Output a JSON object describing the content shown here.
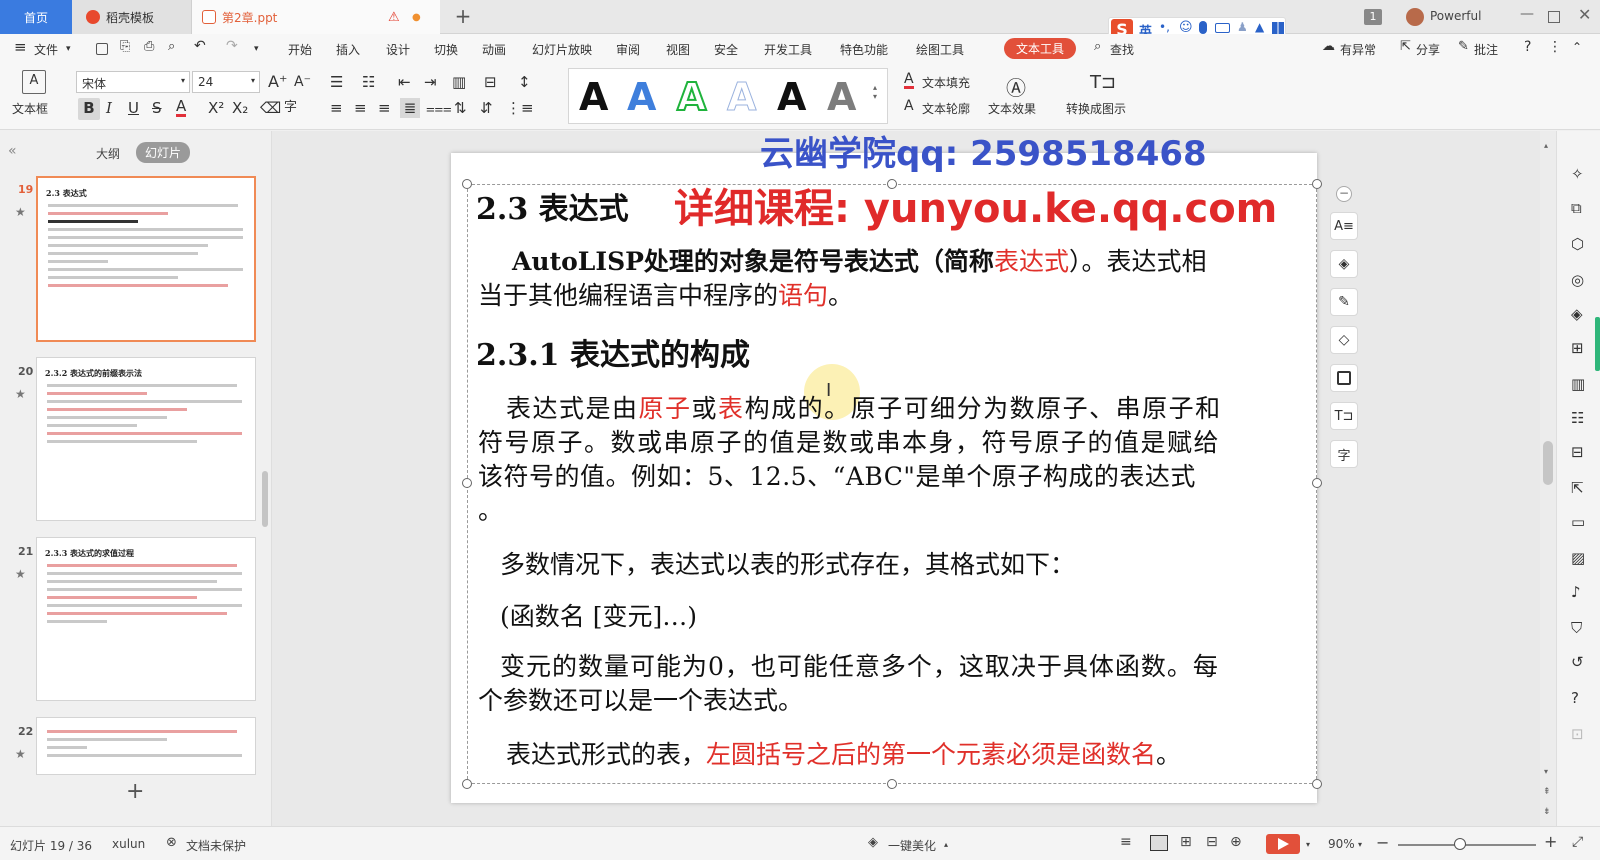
{
  "tabs": {
    "home": "首页",
    "template": "稻壳模板",
    "document": "第2章.ppt"
  },
  "titlebar": {
    "ime_label": "英",
    "page_badge": "1",
    "user": "Powerful"
  },
  "menu": {
    "file": "文件",
    "items": [
      "开始",
      "插入",
      "设计",
      "切换",
      "动画",
      "幻灯片放映",
      "审阅",
      "视图",
      "安全",
      "开发工具",
      "特色功能",
      "绘图工具"
    ],
    "text_tool": "文本工具",
    "search": "查找",
    "changes": "有异常",
    "share": "分享",
    "comment": "批注"
  },
  "ribbon": {
    "textbox": "文本框",
    "font_name": "宋体",
    "font_size": "24",
    "text_fill": "文本填充",
    "text_outline": "文本轮廓",
    "text_effect": "文本效果",
    "convert": "转换成图示"
  },
  "colors": {
    "accent_blue": "#3a7be0",
    "text_tool_red": "#e2503a",
    "slide_red": "#e0302a",
    "watermark_blue": "#3a53c8",
    "watermark_red": "#e02a2a",
    "art_blue": "#3f7fdc",
    "art_green": "#1fb33c",
    "art_gray": "#7d7d7d"
  },
  "left_panel": {
    "tab_outline": "大纲",
    "tab_slides": "幻灯片",
    "thumbnails": [
      {
        "num": "19",
        "title": "2.3 表达式"
      },
      {
        "num": "20",
        "title": "2.3.2 表达式的前缀表示法"
      },
      {
        "num": "21",
        "title": "2.3.3 表达式的求值过程"
      },
      {
        "num": "22",
        "title": ""
      }
    ]
  },
  "watermark": {
    "line1": "云幽学院qq: 2598518468",
    "line2": "详细课程: yunyou.ke.qq.com"
  },
  "slide": {
    "heading": "2.3 表达式",
    "p1_a": "AutoLISP处理的对象是符号表达式（简称",
    "p1_red": "表达式",
    "p1_b": "）。表达式相",
    "p1_c": "当于其他编程语言中程序的",
    "p1_red2": "语句",
    "p1_d": "。",
    "subheading": "2.3.1 表达式的构成",
    "p2_a": "表达式是由",
    "p2_red1": "原子",
    "p2_or": "或",
    "p2_red2": "表",
    "p2_b": "构成的。原子可细分为数原子、串原子和",
    "p2_c": "符号原子。数或串原子的值是数或串本身，符号原子的值是赋给",
    "p2_d": "该符号的值。例如：5、12.5、“ABC\"是单个原子构成的表达式",
    "p2_e": "。",
    "p3": "多数情况下，表达式以表的形式存在，其格式如下：",
    "p4": "(函数名 [变元]…)",
    "p5_a": "变元的数量可能为0，也可能任意多个，这取决于具体函数。每",
    "p5_b": "个参数还可以是一个表达式。",
    "p6_a": "表达式形式的表，",
    "p6_red": "左圆括号之后的第一个元素必须是函数名",
    "p6_b": "。"
  },
  "status": {
    "slide_count": "幻灯片 19 / 36",
    "theme": "xulun",
    "protect": "文档未保护",
    "beautify": "一键美化",
    "zoom": "90%"
  }
}
